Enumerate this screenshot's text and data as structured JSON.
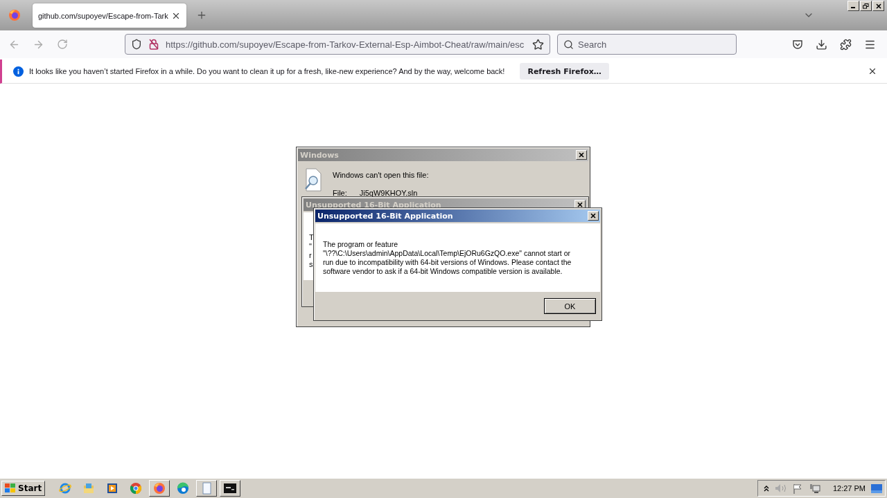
{
  "browser": {
    "tabs": [
      {
        "title": "github.com/supoyev/Escape-from-Tark",
        "selected": true
      }
    ],
    "url": "https://github.com/supoyev/Escape-from-Tarkov-External-Esp-Aimbot-Cheat/raw/main/esc",
    "search": {
      "placeholder": "Search"
    },
    "notification": {
      "message": "It looks like you haven’t started Firefox in a while. Do you want to clean it up for a fresh, like-new experience? And by the way, welcome back!",
      "button": "Refresh Firefox…"
    }
  },
  "dialogs": [
    {
      "title": "Windows",
      "active": false,
      "heading": "Windows can't open this file:",
      "file_label": "File:",
      "file_name": "Ji5qW9KHOY.sln"
    },
    {
      "title": "Unsupported 16-Bit Application",
      "active": false,
      "fragments": [
        "T",
        "\"",
        "r",
        "s"
      ]
    },
    {
      "title": "Unsupported 16-Bit Application",
      "active": true,
      "message_lines": [
        "The program or feature",
        "\"\\??\\C:\\Users\\admin\\AppData\\Local\\Temp\\EjORu6GzQO.exe\" cannot start or",
        "run due to incompatibility with 64-bit versions of Windows. Please contact the",
        "software vendor to ask if a 64-bit Windows compatible version is available."
      ],
      "button": "OK"
    }
  ],
  "taskbar": {
    "start": "Start",
    "apps": [
      {
        "kind": "ie",
        "active": false
      },
      {
        "kind": "folder",
        "active": false
      },
      {
        "kind": "media",
        "active": false
      },
      {
        "kind": "chrome",
        "active": false
      },
      {
        "kind": "firefox",
        "active": true
      },
      {
        "kind": "edge",
        "active": false
      },
      {
        "kind": "notepad",
        "active": true
      },
      {
        "kind": "cmd",
        "active": true
      }
    ],
    "clock": "12:27 PM"
  }
}
